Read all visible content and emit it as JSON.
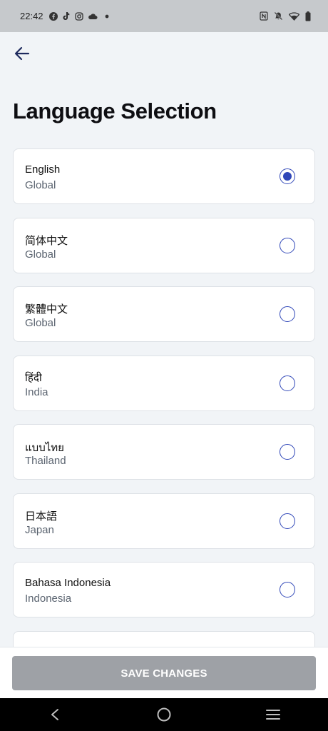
{
  "status_bar": {
    "time": "22:42",
    "left_icons": [
      "facebook-icon",
      "tiktok-icon",
      "instagram-icon",
      "cloud-icon",
      "dot-icon"
    ],
    "right_icons": [
      "nfc-icon",
      "mute-icon",
      "wifi-icon",
      "battery-icon"
    ]
  },
  "header": {
    "back_icon": "arrow-left-icon",
    "title": "Language Selection"
  },
  "languages": [
    {
      "name": "English",
      "region": "Global",
      "selected": true
    },
    {
      "name": "简体中文",
      "region": "Global",
      "selected": false
    },
    {
      "name": "繁體中文",
      "region": "Global",
      "selected": false
    },
    {
      "name": "हिंदी",
      "region": "India",
      "selected": false
    },
    {
      "name": "แบบไทย",
      "region": "Thailand",
      "selected": false
    },
    {
      "name": "日本語",
      "region": "Japan",
      "selected": false
    },
    {
      "name": "Bahasa Indonesia",
      "region": "Indonesia",
      "selected": false
    },
    {
      "name": "",
      "region": "",
      "selected": false
    }
  ],
  "footer": {
    "save_label": "SAVE CHANGES"
  },
  "nav_bar": [
    "back-nav-icon",
    "home-nav-icon",
    "menu-nav-icon"
  ],
  "colors": {
    "accent": "#3047b8",
    "disabled_button": "#9ea1a6",
    "background": "#f1f4f7"
  }
}
